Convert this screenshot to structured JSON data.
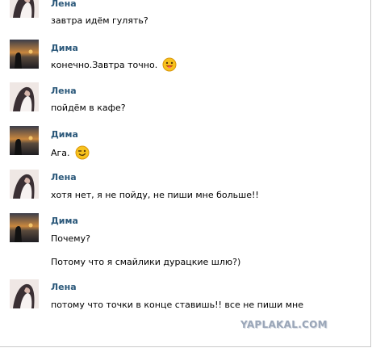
{
  "messages": [
    {
      "author": "Лена",
      "lines": [
        "завтра идём гулять?"
      ]
    },
    {
      "author": "Дима",
      "lines": [
        "конечно.Завтра точно."
      ],
      "emoji": "grin-smiley-icon"
    },
    {
      "author": "Лена",
      "lines": [
        "пойдём в кафе?"
      ]
    },
    {
      "author": "Дима",
      "lines": [
        "Ага."
      ],
      "emoji": "wink-smiley-icon"
    },
    {
      "author": "Лена",
      "lines": [
        "хотя нет, я не пойду, не пиши мне больше!!"
      ]
    },
    {
      "author": "Дима",
      "lines": [
        "Почему?",
        "Потому что я смайлики дурацкие шлю?)"
      ]
    },
    {
      "author": "Лена",
      "lines": [
        "потому что точки в конце ставишь!! все не пиши мне"
      ]
    }
  ],
  "watermark": "YAPLAKAL.COM",
  "colors": {
    "author_name": "#2b587a",
    "watermark": "#9aa6b8"
  }
}
